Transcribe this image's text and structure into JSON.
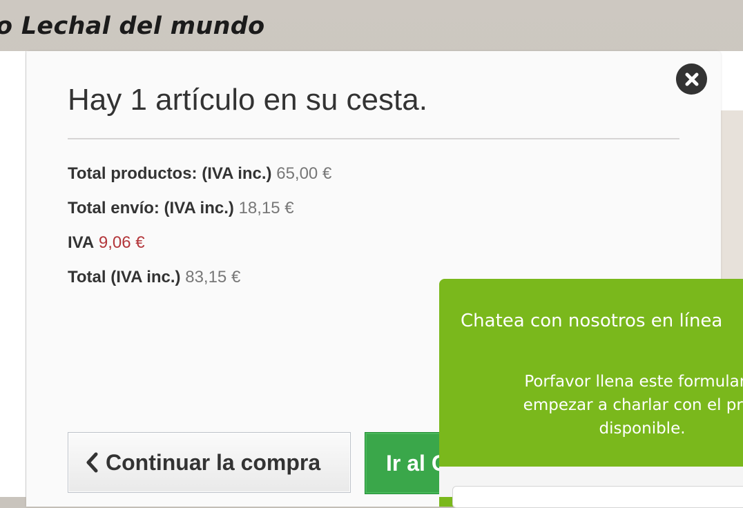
{
  "page": {
    "heading": "o Lechal del mundo"
  },
  "modal": {
    "title": "Hay 1 artículo en su cesta.",
    "close_icon": "close-icon",
    "summary": [
      {
        "label": "Total productos: (IVA inc.)",
        "value": "65,00 €"
      },
      {
        "label": "Total envío: (IVA inc.)",
        "value": "18,15 €"
      },
      {
        "label": "IVA",
        "value": "9,06 €"
      },
      {
        "label": "Total (IVA inc.)",
        "value": "83,15 €"
      }
    ],
    "continue_label": "Continuar la compra",
    "checkout_label": "Ir al C"
  },
  "chat": {
    "title": "Chatea con nosotros en línea",
    "message_line1": "Porfavor llena este formulario",
    "message_line2": "empezar a charlar con el próx",
    "message_line3": "disponible."
  },
  "colors": {
    "chat_green": "#7ab81c",
    "checkout_green": "#3aa74a",
    "tax_red": "#b3363a"
  }
}
